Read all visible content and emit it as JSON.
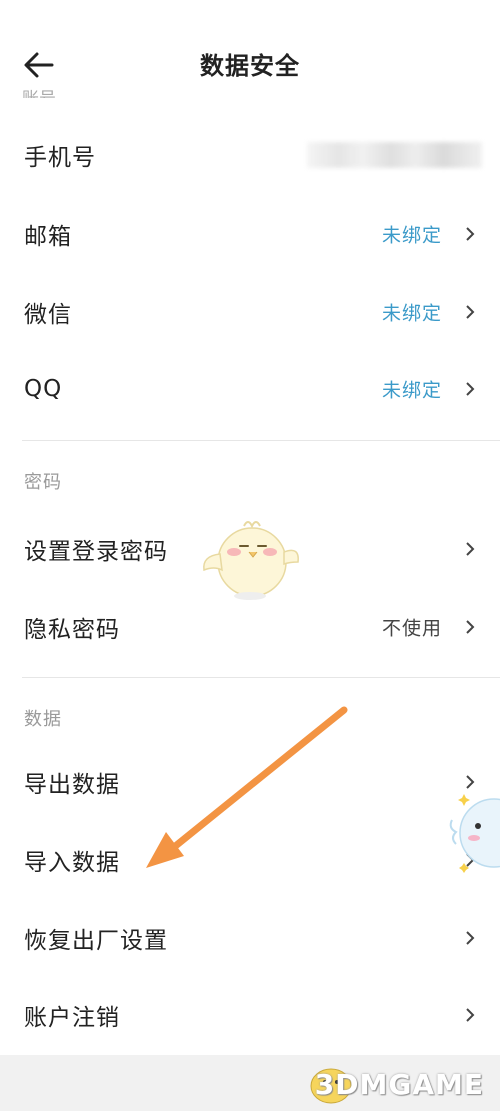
{
  "header": {
    "title": "数据安全",
    "cut_off_label": "账号"
  },
  "account": {
    "items": [
      {
        "label": "手机号",
        "value": ""
      },
      {
        "label": "邮箱",
        "value": "未绑定"
      },
      {
        "label": "微信",
        "value": "未绑定"
      },
      {
        "label": "QQ",
        "value": "未绑定"
      }
    ]
  },
  "password": {
    "section_title": "密码",
    "items": [
      {
        "label": "设置登录密码",
        "value": ""
      },
      {
        "label": "隐私密码",
        "value": "不使用"
      }
    ]
  },
  "data_section": {
    "section_title": "数据",
    "items": [
      {
        "label": "导出数据"
      },
      {
        "label": "导入数据"
      },
      {
        "label": "恢复出厂设置"
      },
      {
        "label": "账户注销"
      }
    ]
  },
  "watermark": {
    "text": "3DMGAME"
  },
  "icons": {
    "back": "back-arrow-icon",
    "chevron": "chevron-right-icon"
  },
  "colors": {
    "link_blue": "#3b9ac9",
    "annotation_arrow": "#f39443"
  }
}
